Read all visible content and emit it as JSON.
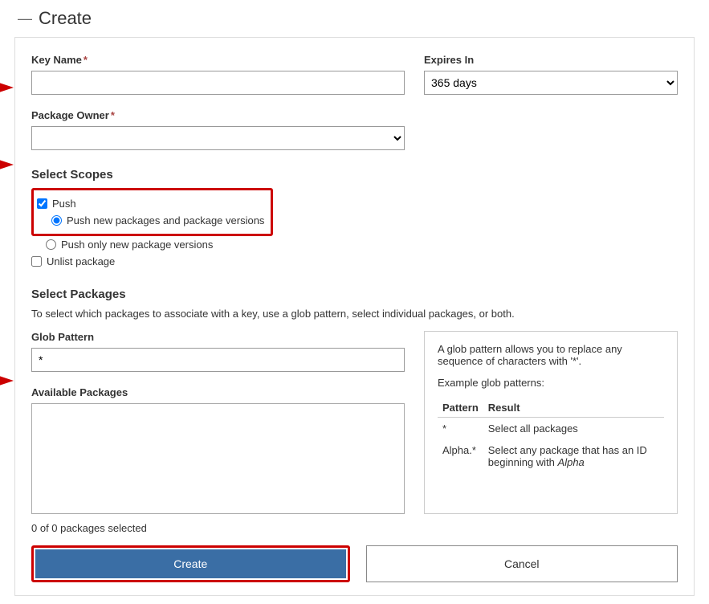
{
  "header": {
    "title": "Create"
  },
  "form": {
    "key_name": {
      "label": "Key Name",
      "value": "",
      "required": true
    },
    "expires_in": {
      "label": "Expires In",
      "value": "365 days"
    },
    "package_owner": {
      "label": "Package Owner",
      "value": "",
      "required": true
    }
  },
  "scopes": {
    "title": "Select Scopes",
    "push": {
      "label": "Push",
      "checked": true
    },
    "push_new_and_versions": {
      "label": "Push new packages and package versions",
      "selected": true
    },
    "push_only_versions": {
      "label": "Push only new package versions",
      "selected": false
    },
    "unlist": {
      "label": "Unlist package",
      "checked": false
    }
  },
  "packages": {
    "title": "Select Packages",
    "help": "To select which packages to associate with a key, use a glob pattern, select individual packages, or both.",
    "glob_label": "Glob Pattern",
    "glob_value": "*",
    "available_label": "Available Packages",
    "count_text": "0 of 0 packages selected"
  },
  "glob_help": {
    "intro": "A glob pattern allows you to replace any sequence of characters with '*'.",
    "examples_title": "Example glob patterns:",
    "col_pattern": "Pattern",
    "col_result": "Result",
    "rows": [
      {
        "pattern": "*",
        "result": "Select all packages"
      },
      {
        "pattern": "Alpha.*",
        "result_pre": "Select any package that has an ID beginning with ",
        "result_em": "Alpha"
      }
    ]
  },
  "buttons": {
    "create": "Create",
    "cancel": "Cancel"
  }
}
